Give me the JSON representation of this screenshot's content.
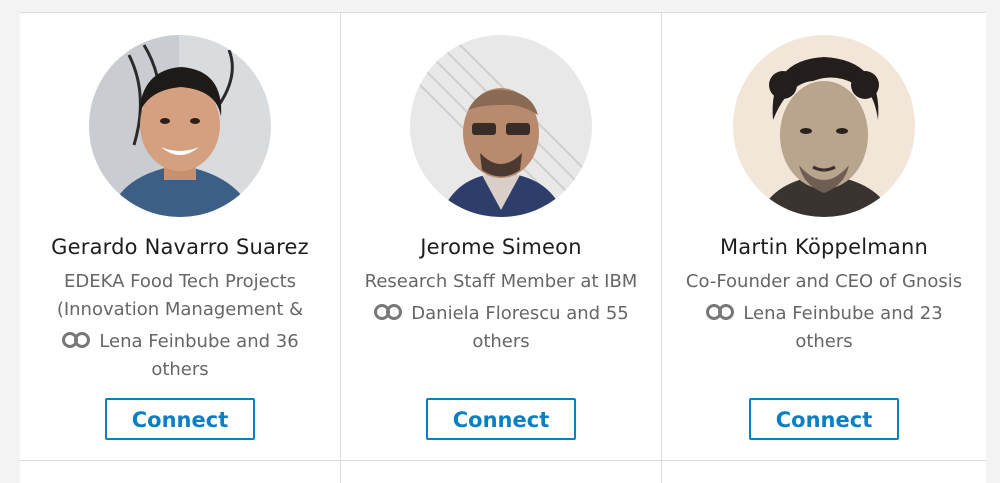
{
  "people": [
    {
      "name": "Gerardo Navarro Suarez",
      "headline_lines": [
        "EDEKA Food Tech Projects",
        "(Innovation Management &"
      ],
      "shared_line1": "Lena Feinbube and 36",
      "shared_line2": "others",
      "connect_label": "Connect",
      "icon": "shared-connections-icon"
    },
    {
      "name": "Jerome Simeon",
      "headline_lines": [
        "Research Staff Member at IBM"
      ],
      "shared_line1": "Daniela Florescu and 55",
      "shared_line2": "others",
      "connect_label": "Connect",
      "icon": "shared-connections-icon"
    },
    {
      "name": "Martin Köppelmann",
      "headline_lines": [
        "Co-Founder and CEO of Gnosis"
      ],
      "shared_line1": "Lena Feinbube and 23",
      "shared_line2": "others",
      "connect_label": "Connect",
      "icon": "shared-connections-icon"
    }
  ],
  "colors": {
    "accent": "#0a7fc2",
    "muted_text": "#666666",
    "name_text": "#1d1d1d",
    "divider": "#dcdcdc"
  }
}
